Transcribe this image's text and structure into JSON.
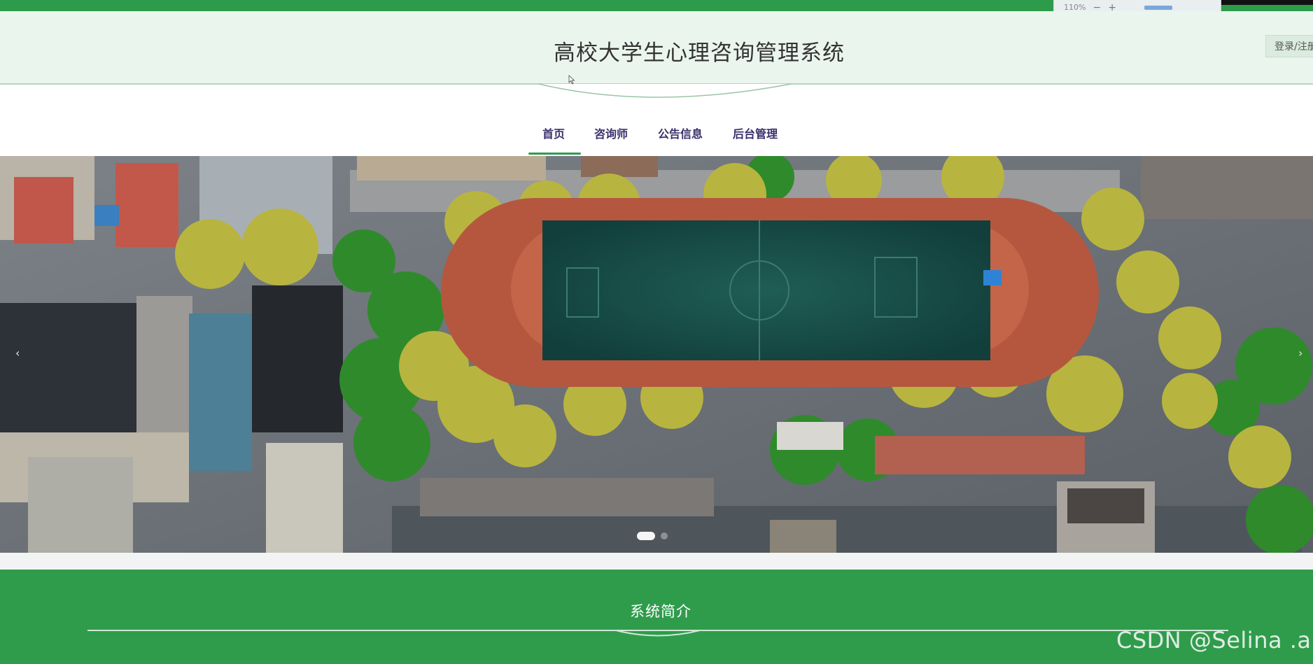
{
  "zoom": {
    "level_text": "110%",
    "minus": "−",
    "plus": "+"
  },
  "header": {
    "title": "高校大学生心理咨询管理系统",
    "login_label": "登录/注册"
  },
  "nav": {
    "items": [
      {
        "label": "首页",
        "active": true
      },
      {
        "label": "咨询师"
      },
      {
        "label": "公告信息"
      },
      {
        "label": "后台管理"
      }
    ]
  },
  "banner": {
    "prev_icon": "‹",
    "next_icon": "›",
    "slide_count": 2,
    "active_slide": 1
  },
  "intro": {
    "title": "系统简介"
  },
  "watermark": {
    "text": "CSDN @Selina .a"
  },
  "colors": {
    "brand_green": "#2e9b4b",
    "header_bg": "#eaf5ee",
    "nav_text": "#3a2f6b"
  }
}
